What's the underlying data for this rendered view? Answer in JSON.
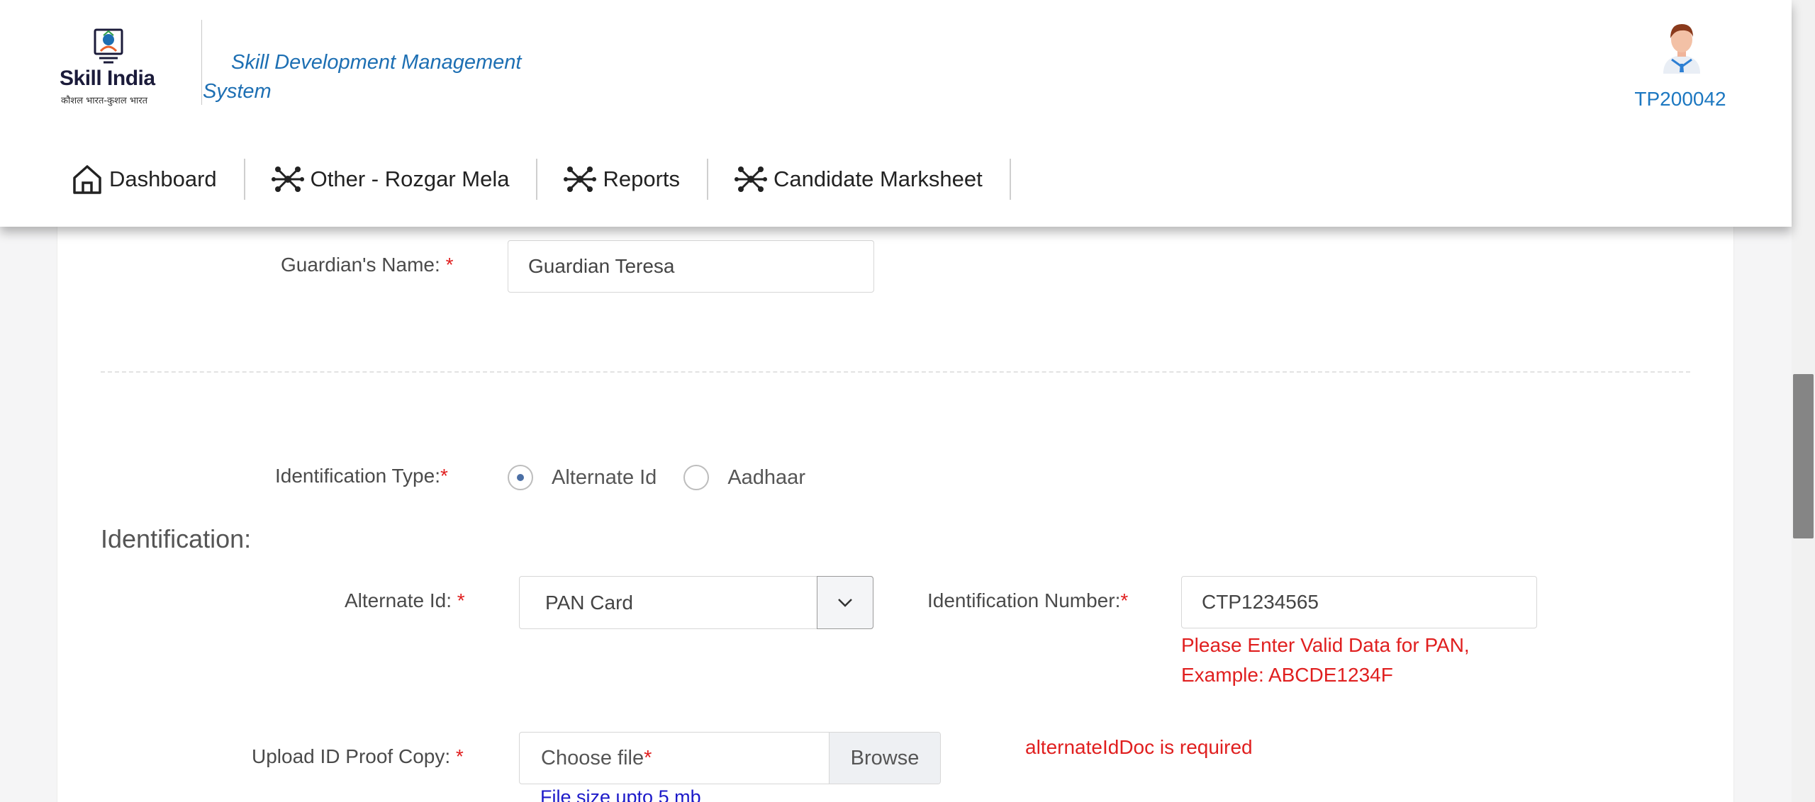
{
  "header": {
    "logo": {
      "title": "Skill India",
      "subtitle": "कौशल भारत-कुशल भारत"
    },
    "system_title": "Skill Development Management System",
    "user_id": "TP200042"
  },
  "nav": {
    "items": [
      {
        "label": "Dashboard",
        "icon": "home-icon"
      },
      {
        "label": "Other - Rozgar Mela",
        "icon": "network-icon"
      },
      {
        "label": "Reports",
        "icon": "network-icon"
      },
      {
        "label": "Candidate Marksheet",
        "icon": "network-icon"
      }
    ]
  },
  "form": {
    "guardian": {
      "label": "Guardian's Name:",
      "required": "*",
      "value": "Guardian Teresa"
    },
    "identification_type": {
      "label": "Identification Type:",
      "required": "*",
      "options": [
        {
          "label": "Alternate Id",
          "checked": true
        },
        {
          "label": "Aadhaar",
          "checked": false
        }
      ]
    },
    "section_title": "Identification:",
    "alternate_id": {
      "label": "Alternate Id:",
      "required": "*",
      "selected": "PAN Card"
    },
    "identification_number": {
      "label": "Identification Number:",
      "required": "*",
      "value": "CTP1234565",
      "error_line1": "Please Enter Valid Data for PAN,",
      "error_line2": "Example: ABCDE1234F"
    },
    "upload": {
      "label": "Upload ID Proof Copy:",
      "required": "*",
      "placeholder": "Choose file",
      "placeholder_required": "*",
      "browse_label": "Browse",
      "error": "alternateIdDoc is required",
      "hint": "File size upto 5 mb"
    }
  },
  "colors": {
    "accent": "#1d78c1",
    "error": "#e01f1f",
    "hint": "#1d1ac9"
  }
}
